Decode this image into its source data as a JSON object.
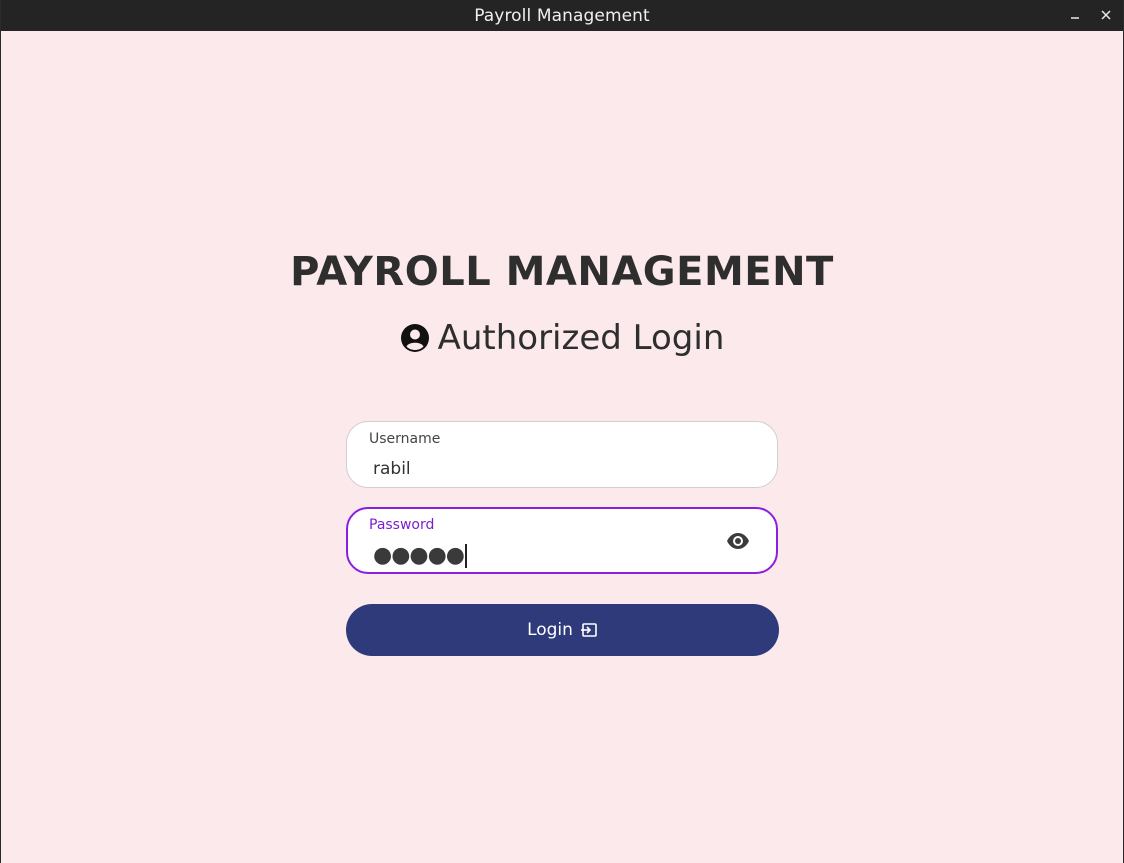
{
  "window": {
    "title": "Payroll Management"
  },
  "page": {
    "heading": "PAYROLL MANAGEMENT",
    "subheading": "Authorized Login"
  },
  "form": {
    "username": {
      "label": "Username",
      "value": "rabil"
    },
    "password": {
      "label": "Password",
      "masked_value": "●●●●●"
    },
    "login_label": "Login"
  },
  "icons": {
    "minimize": "minimize-icon",
    "close": "close-icon",
    "user": "account-circle-icon",
    "visibility": "eye-icon",
    "login": "login-icon"
  },
  "colors": {
    "background": "#fbe9eb",
    "titlebar": "#242424",
    "primary_button": "#2f3a7b",
    "focus_accent": "#8a1fe0"
  }
}
